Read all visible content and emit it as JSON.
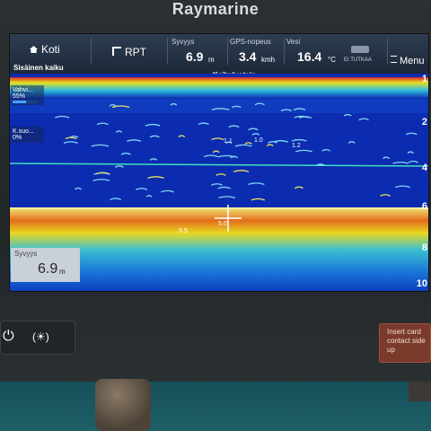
{
  "device": {
    "brand": "Raymarine"
  },
  "topbar": {
    "home_label": "Koti",
    "rpt_label": "RPT",
    "depth": {
      "caption": "Syvyys",
      "value": "6.9",
      "unit": "m"
    },
    "gps_speed": {
      "caption": "GPS-nopeus",
      "value": "3.4",
      "unit": "kmh"
    },
    "water": {
      "caption": "Vesi",
      "value": "16.4",
      "unit": "°C"
    },
    "radar_status": "EI TUTKAA",
    "menu_label": "Menu"
  },
  "subheader": {
    "left": "Sisäinen kaiku",
    "center": "Kaikuluotain"
  },
  "side_panels": [
    {
      "label": "Vahvi...",
      "value": "55%",
      "level": 0.55
    },
    {
      "label": "K.suo...",
      "value": "0%",
      "level": 0
    }
  ],
  "depth_box": {
    "caption": "Syvyys",
    "value": "6.9",
    "unit": "m"
  },
  "scale": [
    "2",
    "4",
    "6",
    "8",
    "10"
  ],
  "scale_top": "1",
  "targets": [
    "1.1",
    "1.0",
    "1.2",
    "5.5",
    "5.0"
  ],
  "buttons": {
    "brightness": "(☀)",
    "power": "⏻"
  },
  "card_slot": {
    "line1": "Insert card",
    "line2": "contact side up"
  },
  "colors": {
    "water": "#0b2bb0",
    "surface": "#e8d020",
    "bottom": "#e36e1c"
  }
}
